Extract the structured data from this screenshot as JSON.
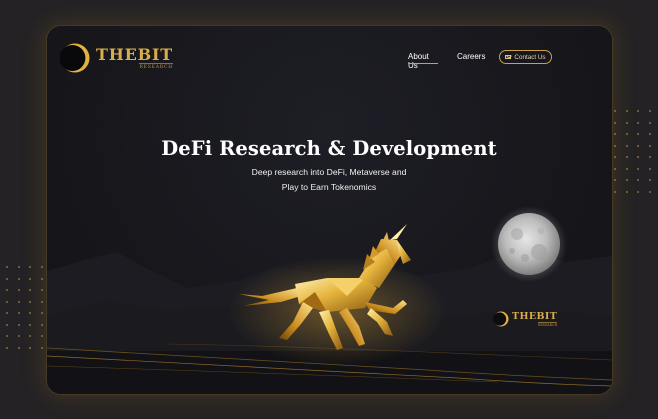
{
  "brand": {
    "name": "THEBIT",
    "tagline": "RESEARCH",
    "gold": "#d8ad4c"
  },
  "nav": {
    "about": "About Us",
    "careers": "Careers",
    "contact": "Contact Us",
    "contact_icon": "mail-icon"
  },
  "hero": {
    "title": "DeFi Research & Development",
    "subtitle_line1": "Deep research into DeFi, Metaverse and",
    "subtitle_line2": "Play to Earn Tokenomics"
  },
  "watermark": {
    "name": "THEBIT",
    "tagline": "RESEARCH"
  },
  "colors": {
    "page_bg": "#242224",
    "panel_bg": "#17171c",
    "accent_gold": "#c9a24a",
    "moon": "#bdbdbd"
  },
  "illustration": {
    "subject": "golden low-poly unicorn galloping",
    "moon": "full moon"
  }
}
